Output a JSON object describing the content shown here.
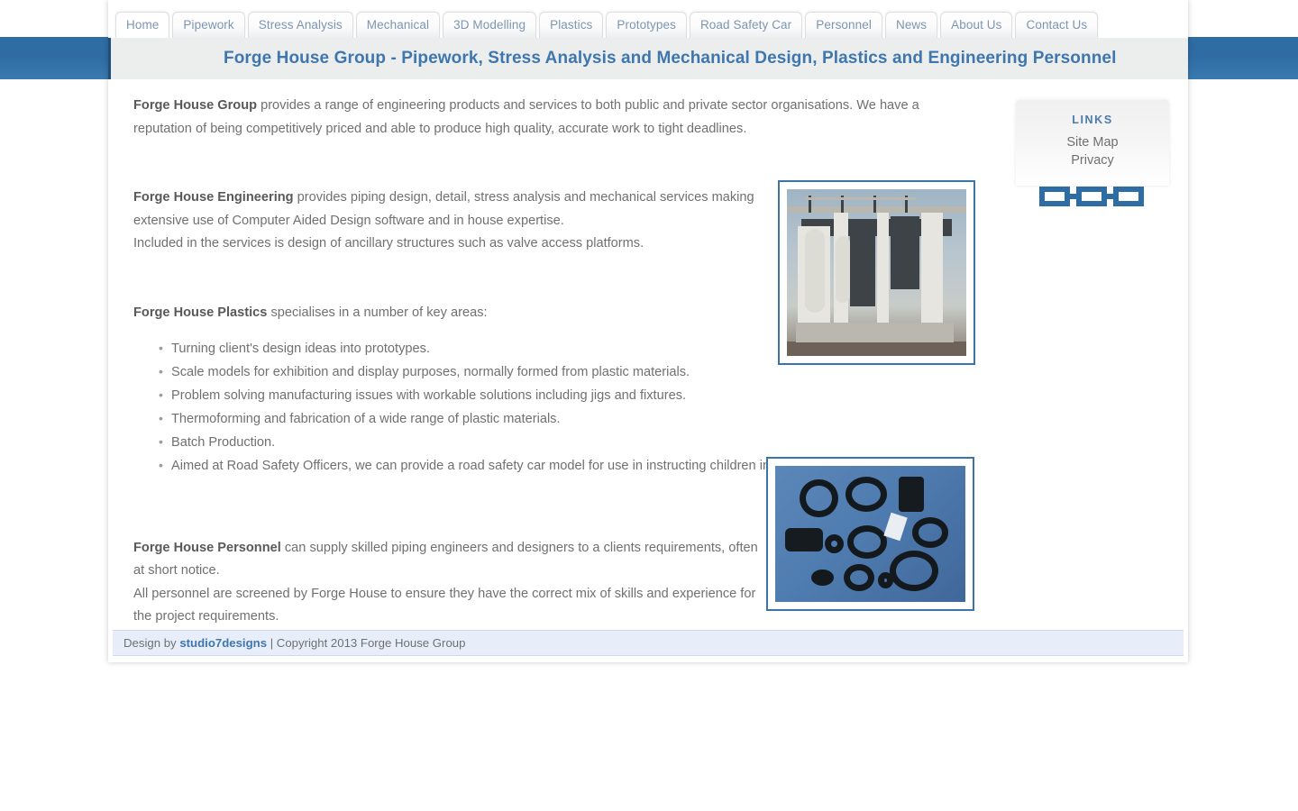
{
  "nav": {
    "tabs": [
      {
        "label": "Home",
        "active": true
      },
      {
        "label": "Pipework",
        "active": false
      },
      {
        "label": "Stress Analysis",
        "active": false
      },
      {
        "label": "Mechanical",
        "active": false
      },
      {
        "label": "3D Modelling",
        "active": false
      },
      {
        "label": "Plastics",
        "active": false
      },
      {
        "label": "Prototypes",
        "active": false
      },
      {
        "label": "Road Safety Car",
        "active": false
      },
      {
        "label": "Personnel",
        "active": false
      },
      {
        "label": "News",
        "active": false
      },
      {
        "label": "About Us",
        "active": false
      },
      {
        "label": "Contact Us",
        "active": false
      }
    ]
  },
  "header": {
    "title": "Forge House Group - Pipework, Stress Analysis and Mechanical Design, Plastics and Engineering Personnel"
  },
  "main": {
    "paragraphs": [
      {
        "lead": "Forge House Group",
        "text": " provides a range of engineering products and services to both public and private sector organisations. We have a reputation of being competitively priced and able to produce high quality, accurate work to tight deadlines."
      },
      {
        "lead": "Forge House Engineering",
        "text": " provides piping design, detail, stress analysis and mechanical services making extensive use of Computer Aided Design software and in house expertise.",
        "extra": "Included in the services is design of ancillary structures such as valve access platforms."
      },
      {
        "lead": "Forge House Plastics",
        "text": " specialises in a number of key areas:"
      },
      {
        "lead": "Forge House Personnel",
        "text": " can supply skilled piping engineers and designers to a clients requirements, often at short notice.",
        "extra": "All personnel are screened by Forge House to ensure they have the correct mix of skills and experience for the project requirements."
      }
    ],
    "key_areas": [
      "Turning client's design ideas into prototypes.",
      "Scale models for exhibition and display purposes, normally formed from plastic materials.",
      "Problem solving manufacturing issues with workable solutions including jigs and fixtures.",
      "Thermoforming and fabrication of a wide range of plastic materials.",
      "Batch Production.",
      "Aimed at Road Safety Officers, we can provide a road safety car model for use in instructing children in road safety."
    ],
    "images": [
      {
        "name": "pipework-module-photo",
        "alt": "Industrial pipework skid module"
      },
      {
        "name": "plastic-components-photo",
        "alt": "Black moulded plastic components"
      }
    ]
  },
  "sidebar": {
    "heading": "LINKS",
    "items": [
      {
        "label": "Site Map"
      },
      {
        "label": "Privacy"
      }
    ],
    "icon": "chain-link-icon"
  },
  "footer": {
    "prefix": "Design by ",
    "designer": "studio7designs",
    "suffix": " | Copyright 2013 Forge House Group"
  },
  "colors": {
    "banner_blue": "#2e6da4",
    "title_blue": "#3f76ad",
    "tab_text": "#7d95b0",
    "body_text": "#6f7072",
    "photo_border": "#3b75a8",
    "footer_bg": "#e7eefa",
    "links_heading": "#4c7aab"
  }
}
